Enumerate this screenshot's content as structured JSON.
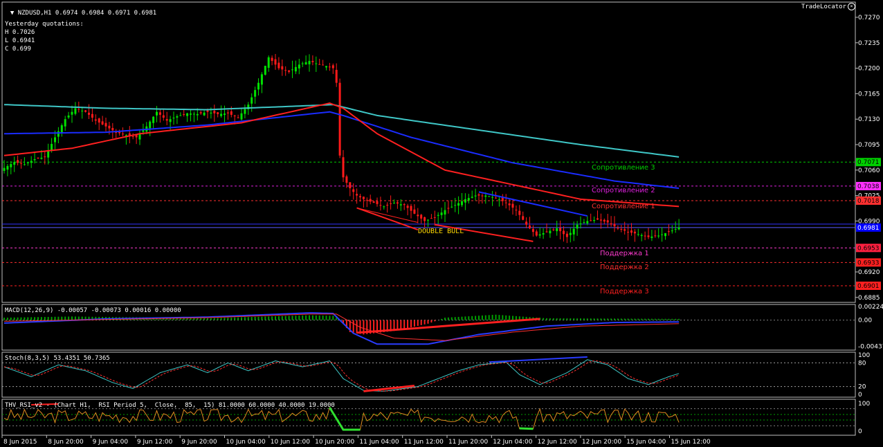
{
  "header": {
    "symbol": "NZDUSD,H1",
    "quote": "0.6974 0.6984 0.6971 0.6981",
    "tradelocator": "TradeLocator"
  },
  "yesterday": {
    "title": "Yesterday quotations:",
    "high": "H 0.7026",
    "low": "L 0.6941",
    "close": "C 0.699"
  },
  "levels": {
    "r3": "Сопротивление 3",
    "r2": "Сопротивление 2",
    "r1": "Сопротивление 1",
    "s1": "Поддержка 1",
    "s2": "Поддержка 2",
    "s3": "Поддержка 3"
  },
  "pattern": "DOUBLE BULL",
  "colors": {
    "bull": "#00e000",
    "bear": "#ff1a1a",
    "ma_cyan": "#3fc7c7",
    "ma_blue": "#1a2cff",
    "ma_red": "#ff2020",
    "r3": "#00d000",
    "r2": "#e020e0",
    "r1": "#ff3030",
    "s1": "#ff3ad0",
    "s2": "#ff2e2e",
    "s3": "#ff2020"
  },
  "indicators": {
    "macd_label": "MACD(12,26,9) -0.00057 -0.00073 0.00016 0.00000",
    "stoch_label": "Stoch(8,3,5) 53.4351 50.7365",
    "rsi_label": "THV_RSI_v2 - (Chart H1,  RSI Period 5,  Close,  85,  15) 81.0000 60.0000 40.0000 19.0000"
  },
  "chart_data": {
    "type": "candlestick",
    "symbol": "NZDUSD",
    "timeframe": "H1",
    "price_ticks": [
      "0.7270",
      "0.7235",
      "0.7200",
      "0.7165",
      "0.7130",
      "0.7095",
      "0.7060",
      "0.7025",
      "0.6990",
      "0.6920",
      "0.6885"
    ],
    "price_ylim": [
      0.6875,
      0.728
    ],
    "level_values": {
      "r3": "0.7071",
      "r2": "0.7038",
      "r1": "0.7018",
      "current": "0.6981",
      "s1": "0.6953",
      "s2": "0.6933",
      "s3": "0.6901"
    },
    "time_ticks": [
      "8 Jun 2015",
      "8 Jun 20:00",
      "9 Jun 04:00",
      "9 Jun 12:00",
      "9 Jun 20:00",
      "10 Jun 04:00",
      "10 Jun 12:00",
      "10 Jun 20:00",
      "11 Jun 04:00",
      "11 Jun 12:00",
      "11 Jun 20:00",
      "12 Jun 04:00",
      "12 Jun 12:00",
      "12 Jun 20:00",
      "15 Jun 04:00",
      "15 Jun 12:00"
    ],
    "close_path": [
      [
        0,
        0.7063
      ],
      [
        3,
        0.7071
      ],
      [
        6,
        0.7068
      ],
      [
        9,
        0.7075
      ],
      [
        12,
        0.7078
      ],
      [
        15,
        0.7105
      ],
      [
        18,
        0.713
      ],
      [
        21,
        0.7145
      ],
      [
        24,
        0.714
      ],
      [
        27,
        0.7128
      ],
      [
        30,
        0.712
      ],
      [
        33,
        0.7112
      ],
      [
        36,
        0.7108
      ],
      [
        39,
        0.7105
      ],
      [
        42,
        0.712
      ],
      [
        45,
        0.714
      ],
      [
        48,
        0.7128
      ],
      [
        51,
        0.7134
      ],
      [
        54,
        0.7138
      ],
      [
        57,
        0.7137
      ],
      [
        60,
        0.714
      ],
      [
        63,
        0.7137
      ],
      [
        66,
        0.7138
      ],
      [
        69,
        0.7132
      ],
      [
        72,
        0.715
      ],
      [
        75,
        0.718
      ],
      [
        78,
        0.7215
      ],
      [
        81,
        0.72
      ],
      [
        84,
        0.7195
      ],
      [
        87,
        0.7205
      ],
      [
        90,
        0.721
      ],
      [
        93,
        0.7205
      ],
      [
        95,
        0.7203
      ],
      [
        97,
        0.72
      ],
      [
        98,
        0.718
      ],
      [
        99,
        0.708
      ],
      [
        100,
        0.705
      ],
      [
        102,
        0.7035
      ],
      [
        104,
        0.7025
      ],
      [
        106,
        0.702
      ],
      [
        109,
        0.7015
      ],
      [
        112,
        0.701
      ],
      [
        115,
        0.7015
      ],
      [
        118,
        0.7012
      ],
      [
        121,
        0.7
      ],
      [
        124,
        0.699
      ],
      [
        127,
        0.6995
      ],
      [
        130,
        0.7005
      ],
      [
        133,
        0.7012
      ],
      [
        136,
        0.702
      ],
      [
        139,
        0.7025
      ],
      [
        142,
        0.7025
      ],
      [
        145,
        0.7022
      ],
      [
        148,
        0.7015
      ],
      [
        151,
        0.7005
      ],
      [
        154,
        0.6985
      ],
      [
        157,
        0.697
      ],
      [
        160,
        0.6975
      ],
      [
        163,
        0.698
      ],
      [
        166,
        0.6968
      ],
      [
        169,
        0.6985
      ],
      [
        172,
        0.699
      ],
      [
        175,
        0.6992
      ],
      [
        178,
        0.6988
      ],
      [
        181,
        0.698
      ],
      [
        184,
        0.6975
      ],
      [
        187,
        0.6972
      ],
      [
        190,
        0.6968
      ],
      [
        193,
        0.697
      ],
      [
        196,
        0.6975
      ],
      [
        199,
        0.6981
      ]
    ],
    "ma_cyan": [
      [
        0,
        0.715
      ],
      [
        30,
        0.7145
      ],
      [
        60,
        0.7143
      ],
      [
        97,
        0.715
      ],
      [
        110,
        0.7135
      ],
      [
        140,
        0.7115
      ],
      [
        170,
        0.7095
      ],
      [
        199,
        0.7078
      ]
    ],
    "ma_blue": [
      [
        0,
        0.711
      ],
      [
        30,
        0.7112
      ],
      [
        60,
        0.7122
      ],
      [
        96,
        0.714
      ],
      [
        100,
        0.7135
      ],
      [
        120,
        0.7105
      ],
      [
        150,
        0.707
      ],
      [
        180,
        0.7045
      ],
      [
        199,
        0.7035
      ]
    ],
    "ma_red": [
      [
        0,
        0.708
      ],
      [
        20,
        0.709
      ],
      [
        40,
        0.711
      ],
      [
        70,
        0.7125
      ],
      [
        96,
        0.7152
      ],
      [
        100,
        0.7145
      ],
      [
        110,
        0.711
      ],
      [
        130,
        0.706
      ],
      [
        150,
        0.704
      ],
      [
        170,
        0.702
      ],
      [
        199,
        0.701
      ]
    ],
    "macd": {
      "label": "MACD(12,26,9) -0.00057 -0.00073 0.00016 0.00000",
      "ticks": [
        "0.00224",
        "0.00",
        "-0.00437"
      ],
      "ylim": [
        -0.005,
        0.0026
      ]
    },
    "stoch": {
      "label": "Stoch(8,3,5) 53.4351 50.7365",
      "ticks": [
        "100",
        "80",
        "20",
        "0"
      ],
      "ylim": [
        0,
        100
      ],
      "value": 53.4351,
      "signal": 50.7365
    },
    "rsi": {
      "label": "THV_RSI_v2 - (Chart H1,  RSI Period 5,  Close,  85,  15) 81.0000 60.0000 40.0000 19.0000",
      "ticks": [
        "100",
        "0"
      ],
      "ylim": [
        0,
        100
      ],
      "levels": [
        81,
        60,
        40,
        19
      ]
    }
  }
}
